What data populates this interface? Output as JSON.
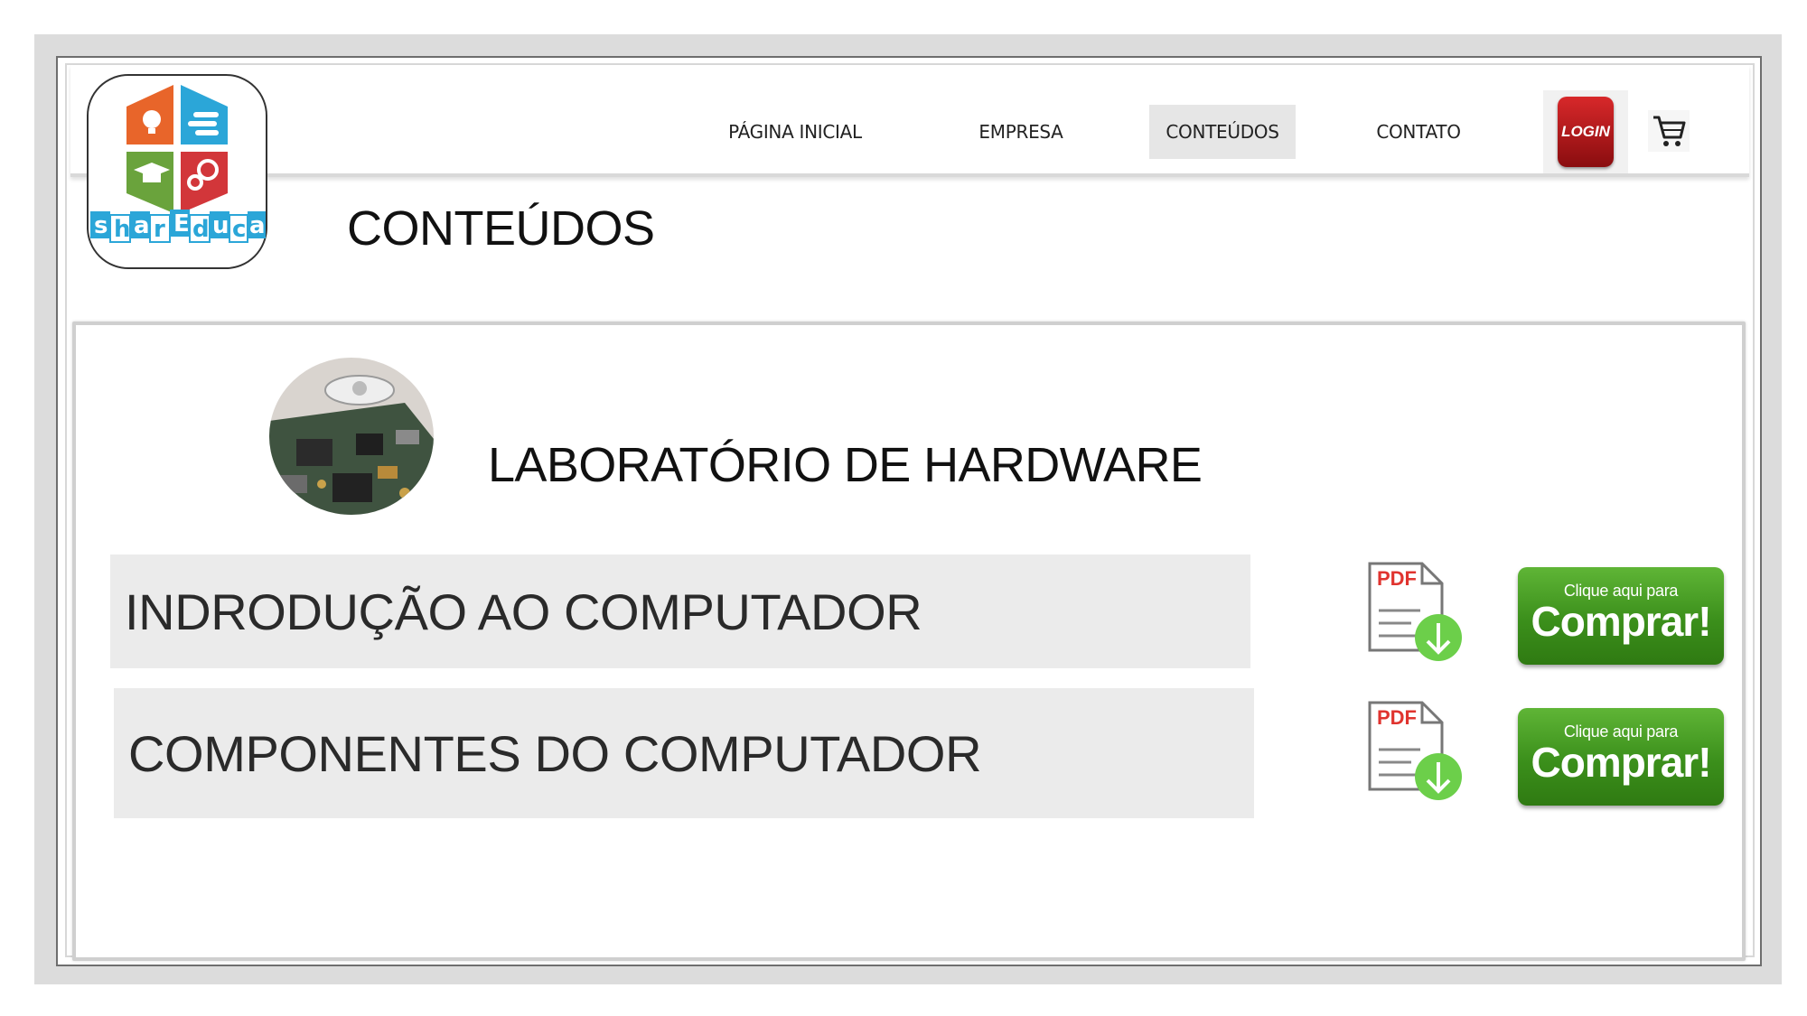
{
  "brand": {
    "logo_text": "sharEduca",
    "colors": {
      "orange": "#e8652a",
      "blue": "#2ba6d8",
      "green": "#6aa33c",
      "red": "#d2363a"
    }
  },
  "nav": {
    "items": [
      {
        "label": "PÁGINA INICIAL",
        "active": false
      },
      {
        "label": "EMPRESA",
        "active": false
      },
      {
        "label": "CONTEÚDOS",
        "active": true
      },
      {
        "label": "CONTATO",
        "active": false
      }
    ],
    "login_label": "LOGIN",
    "cart_icon": "cart-icon"
  },
  "page": {
    "title": "CONTEÚDOS"
  },
  "course": {
    "title": "LABORATÓRIO DE HARDWARE",
    "image": "hard-drive-circuit-board-photo",
    "modules": [
      {
        "title": "INDRODUÇÃO AO COMPUTADOR",
        "pdf_label": "PDF",
        "buy_small": "Clique aqui para",
        "buy_big": "Comprar!"
      },
      {
        "title": "COMPONENTES DO COMPUTADOR",
        "pdf_label": "PDF",
        "buy_small": "Clique aqui para",
        "buy_big": "Comprar!"
      }
    ]
  },
  "colors": {
    "buy_green": "#3b8f1b",
    "login_red": "#b81b1d",
    "row_gray": "#ebebeb",
    "pdf_green": "#6ccf4a",
    "pdf_red": "#e0342f"
  }
}
